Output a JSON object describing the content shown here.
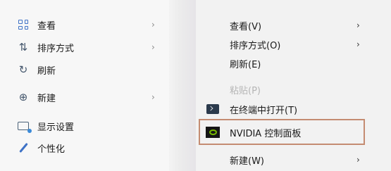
{
  "left_menu": {
    "items": [
      {
        "label": "查看",
        "icon": "grid-icon",
        "has_submenu": true
      },
      {
        "label": "排序方式",
        "icon": "sort-icon",
        "has_submenu": true
      },
      {
        "label": "刷新",
        "icon": "refresh-icon",
        "has_submenu": false
      },
      {
        "label": "新建",
        "icon": "plus-circle-icon",
        "has_submenu": true
      },
      {
        "label": "显示设置",
        "icon": "display-icon",
        "has_submenu": false
      },
      {
        "label": "个性化",
        "icon": "brush-icon",
        "has_submenu": false
      }
    ]
  },
  "right_menu": {
    "items": [
      {
        "label": "查看(V)",
        "has_submenu": true,
        "disabled": false
      },
      {
        "label": "排序方式(O)",
        "has_submenu": true,
        "disabled": false
      },
      {
        "label": "刷新(E)",
        "has_submenu": false,
        "disabled": false
      },
      {
        "label": "粘贴(P)",
        "has_submenu": false,
        "disabled": true
      },
      {
        "label": "在终端中打开(T)",
        "icon": "terminal-icon",
        "has_submenu": false,
        "disabled": false
      },
      {
        "label": "NVIDIA 控制面板",
        "icon": "nvidia-icon",
        "has_submenu": false,
        "disabled": false,
        "highlighted": true
      },
      {
        "label": "新建(W)",
        "has_submenu": true,
        "disabled": false
      }
    ]
  },
  "glyphs": {
    "chevron": "›",
    "sort": "⇅",
    "refresh": "↻",
    "plus_circle": "⊕"
  },
  "colors": {
    "highlight_border": "#c48c72",
    "nvidia_green": "#76b900"
  }
}
